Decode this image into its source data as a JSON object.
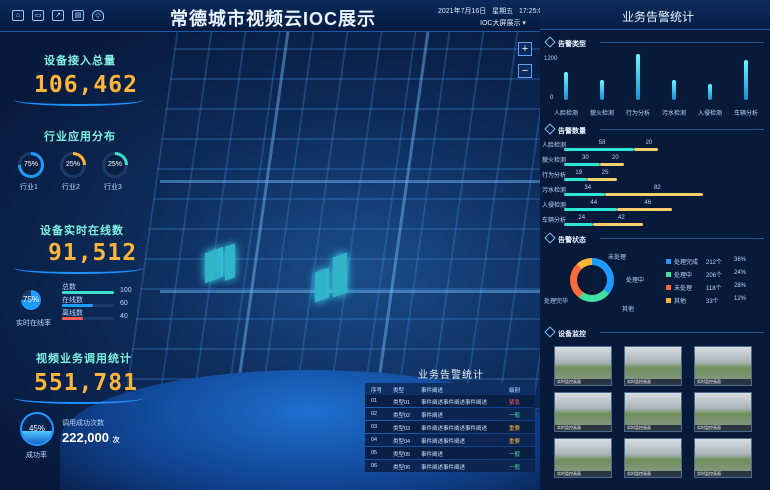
{
  "header": {
    "title": "常德城市视频云IOC展示",
    "date": "2021年7月16日",
    "weekday": "星期五",
    "time": "17:25:00",
    "screen_label": "IOC大屏展示",
    "icons": [
      "home-icon",
      "monitor-icon",
      "export-icon",
      "layers-icon",
      "shield-icon"
    ]
  },
  "left": {
    "device_access": {
      "title": "设备接入总量",
      "value": "106,462"
    },
    "industry": {
      "title": "行业应用分布",
      "items": [
        {
          "label": "行业1",
          "percent": "75%",
          "fraction": 0.75,
          "color": "#1e9bff"
        },
        {
          "label": "行业2",
          "percent": "25%",
          "fraction": 0.25,
          "color": "#ffb53a"
        },
        {
          "label": "行业3",
          "percent": "25%",
          "fraction": 0.25,
          "color": "#3fe0c8"
        }
      ]
    },
    "online": {
      "title": "设备实时在线数",
      "value": "91,512",
      "rate": "75%",
      "rate_fraction": 0.75,
      "rate_label": "实时在线率",
      "rows": [
        {
          "label": "总数",
          "value": "100",
          "fraction": 1.0,
          "color": "#3fe0c8"
        },
        {
          "label": "在线数",
          "value": "60",
          "fraction": 0.6,
          "color": "#1e9bff"
        },
        {
          "label": "离线数",
          "value": "40",
          "fraction": 0.4,
          "color": "#ff5a5a"
        }
      ]
    },
    "calls": {
      "title": "视频业务调用统计",
      "value": "551,781",
      "success_rate": "45%",
      "success_fraction": 0.45,
      "success_label": "成功率",
      "count_label": "调用成功次数",
      "count_value": "222,000",
      "count_unit": "次"
    }
  },
  "right": {
    "title": "业务告警统计",
    "type_section": "告警类型",
    "type_chart": {
      "y_ticks": [
        "1200",
        "0"
      ],
      "categories": [
        "人脸检测",
        "貌火检测",
        "行为分析",
        "污水检测",
        "入侵检测",
        "车辆分析"
      ],
      "values": [
        700,
        500,
        1150,
        500,
        400,
        1000
      ],
      "ylim": [
        0,
        1200
      ]
    },
    "count_section": "告警数量",
    "count_chart": {
      "rows": [
        {
          "label": "人脸检测",
          "a": 58,
          "b": 20
        },
        {
          "label": "貌火检测",
          "a": 30,
          "b": 20
        },
        {
          "label": "行为分析",
          "a": 19,
          "b": 25
        },
        {
          "label": "污水检测",
          "a": 34,
          "b": 82
        },
        {
          "label": "入侵检测",
          "a": 44,
          "b": 46
        },
        {
          "label": "车辆分析",
          "a": 24,
          "b": 42
        }
      ],
      "max": 100
    },
    "status_section": "告警状态",
    "status": {
      "ring_labels": [
        "未处理",
        "处理中",
        "处理完毕",
        "其他"
      ],
      "legend": [
        {
          "label": "处理完成",
          "count": "212个",
          "pct": "36%",
          "color": "#1e9bff"
        },
        {
          "label": "处理中",
          "count": "206个",
          "pct": "24%",
          "color": "#3fe0a0"
        },
        {
          "label": "未处理",
          "count": "118个",
          "pct": "28%",
          "color": "#ff6a3d"
        },
        {
          "label": "其他",
          "count": "33个",
          "pct": "12%",
          "color": "#ffb53a"
        }
      ]
    },
    "monitor_section": "设备监控",
    "cam_caption": "实时监控画面"
  },
  "table": {
    "title": "业务告警统计",
    "headers": [
      "序号",
      "类型",
      "事件阐述",
      "级别"
    ],
    "rows": [
      {
        "no": "01",
        "type": "类型01",
        "desc": "事件阐述事件阐述事件阐述",
        "level": "紧急",
        "color": "#ff5a5a"
      },
      {
        "no": "02",
        "type": "类型02",
        "desc": "事件阐述",
        "level": "一般",
        "color": "#3fe0a0"
      },
      {
        "no": "03",
        "type": "类型03",
        "desc": "事件阐述事件阐述事件阐述",
        "level": "重要",
        "color": "#ffb53a"
      },
      {
        "no": "04",
        "type": "类型04",
        "desc": "事件阐述事件阐述",
        "level": "重要",
        "color": "#ffb53a"
      },
      {
        "no": "05",
        "type": "类型05",
        "desc": "事件阐述",
        "level": "一般",
        "color": "#3fe0a0"
      },
      {
        "no": "06",
        "type": "类型06",
        "desc": "事件阐述事件阐述",
        "level": "一般",
        "color": "#3fe0a0"
      }
    ]
  },
  "map": {
    "zoom_in": "+",
    "zoom_out": "−"
  }
}
